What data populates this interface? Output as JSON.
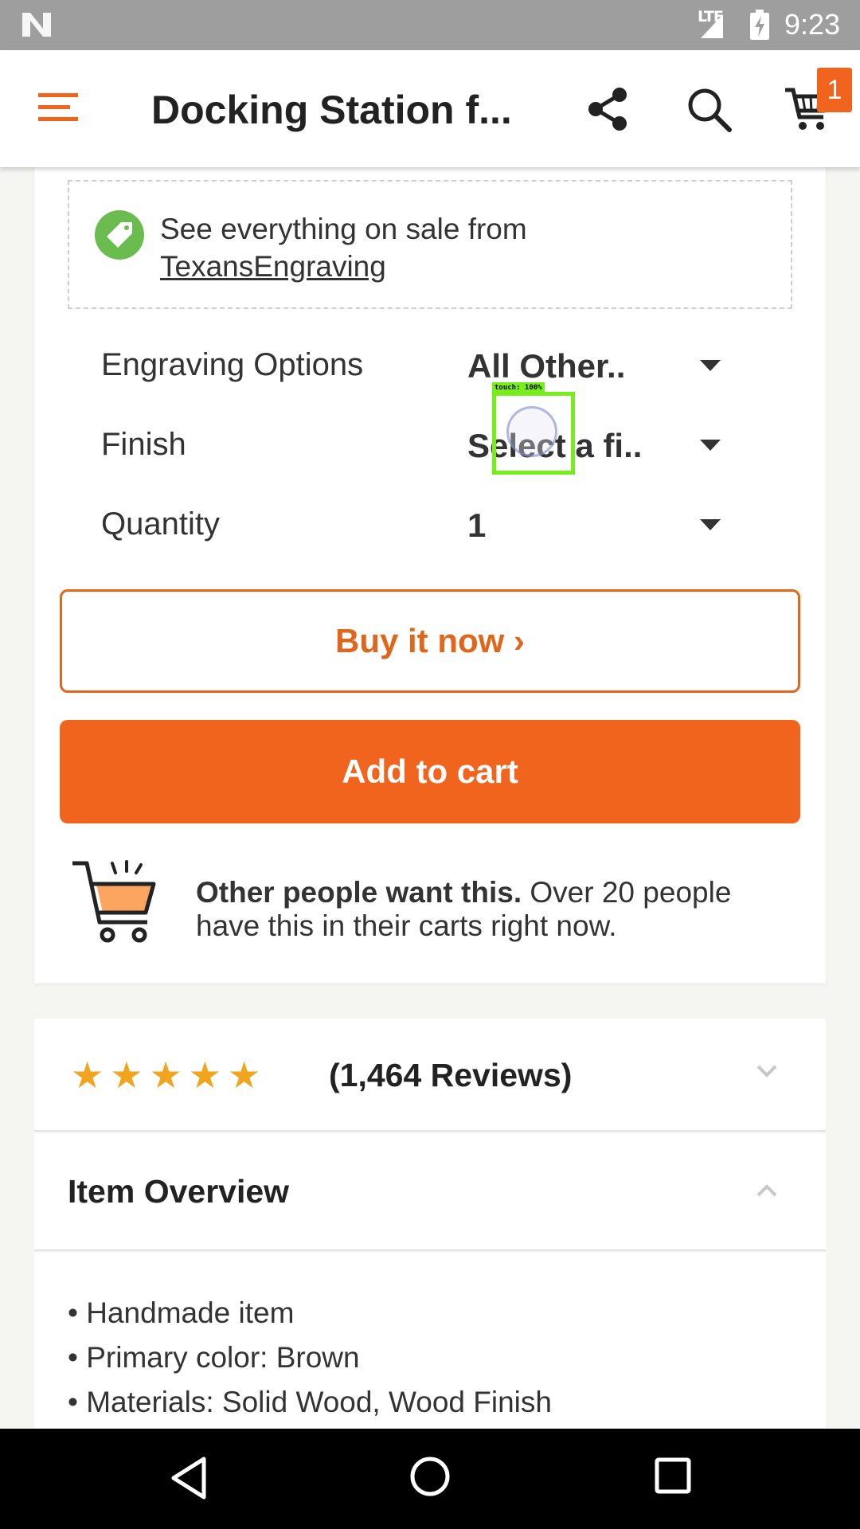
{
  "status_bar": {
    "network": "LTE",
    "time": "9:23"
  },
  "app_bar": {
    "title": "Docking Station f...",
    "cart_count": "1"
  },
  "sale_banner": {
    "text": "See everything on sale from",
    "shop_name": "TexansEngraving"
  },
  "options": [
    {
      "label": "Engraving Options",
      "value": "All Other.."
    },
    {
      "label": "Finish",
      "value": "Select a fi.."
    },
    {
      "label": "Quantity",
      "value": "1"
    }
  ],
  "buttons": {
    "buy_now": "Buy it now ›",
    "add_to_cart": "Add to cart"
  },
  "social_proof": {
    "bold": "Other people want this.",
    "rest": " Over 20 people have this in their carts right now."
  },
  "reviews": {
    "stars": "★★★★★",
    "rating": 5,
    "count_label": "(1,464 Reviews)"
  },
  "item_overview": {
    "title": "Item Overview",
    "items": [
      "Handmade item",
      "Primary color: Brown",
      "Materials: Solid Wood, Wood Finish"
    ]
  },
  "touch_overlay": {
    "label": "touch: 100%"
  },
  "colors": {
    "accent": "#f1641e",
    "sale_green": "#6abc4f",
    "star": "#f1a41e"
  }
}
